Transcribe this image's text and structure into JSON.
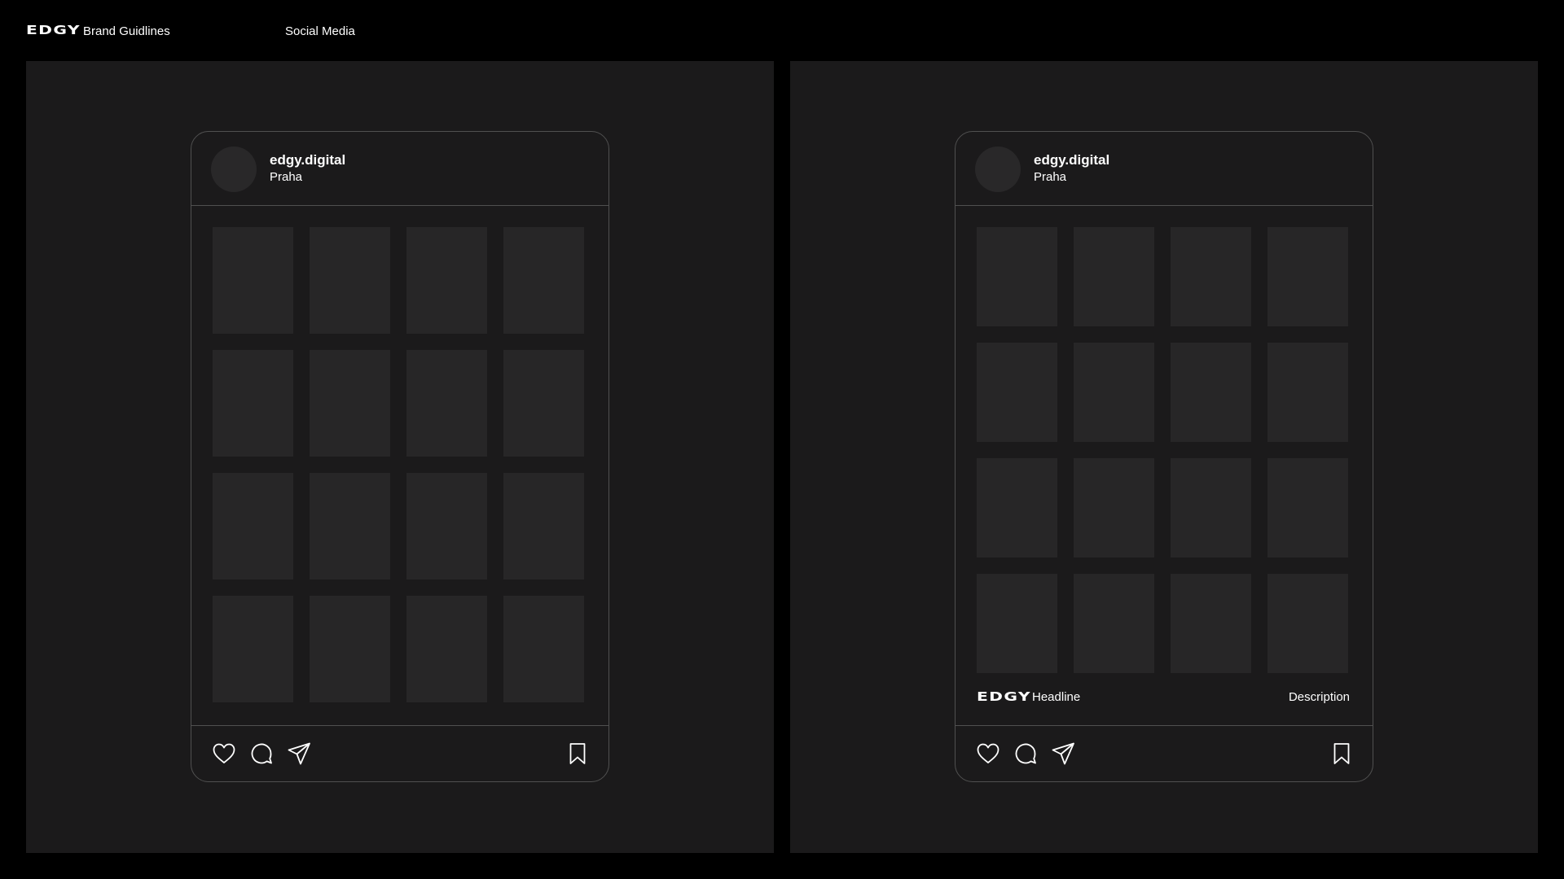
{
  "header": {
    "logo": "EDGY",
    "brand_title": "Brand Guidlines",
    "section_title": "Social Media"
  },
  "posts": [
    {
      "username": "edgy.digital",
      "location": "Praha"
    },
    {
      "username": "edgy.digital",
      "location": "Praha",
      "caption": {
        "logo": "EDGY",
        "headline": "Headline",
        "description": "Description"
      }
    }
  ],
  "icons": {
    "like": "heart-icon",
    "comment": "comment-icon",
    "share": "send-icon",
    "save": "bookmark-icon"
  },
  "colors": {
    "background": "#000000",
    "panel": "#1b1a1b",
    "tile": "#272627",
    "avatar": "#292829",
    "outline": "#505050",
    "text": "#ffffff"
  }
}
